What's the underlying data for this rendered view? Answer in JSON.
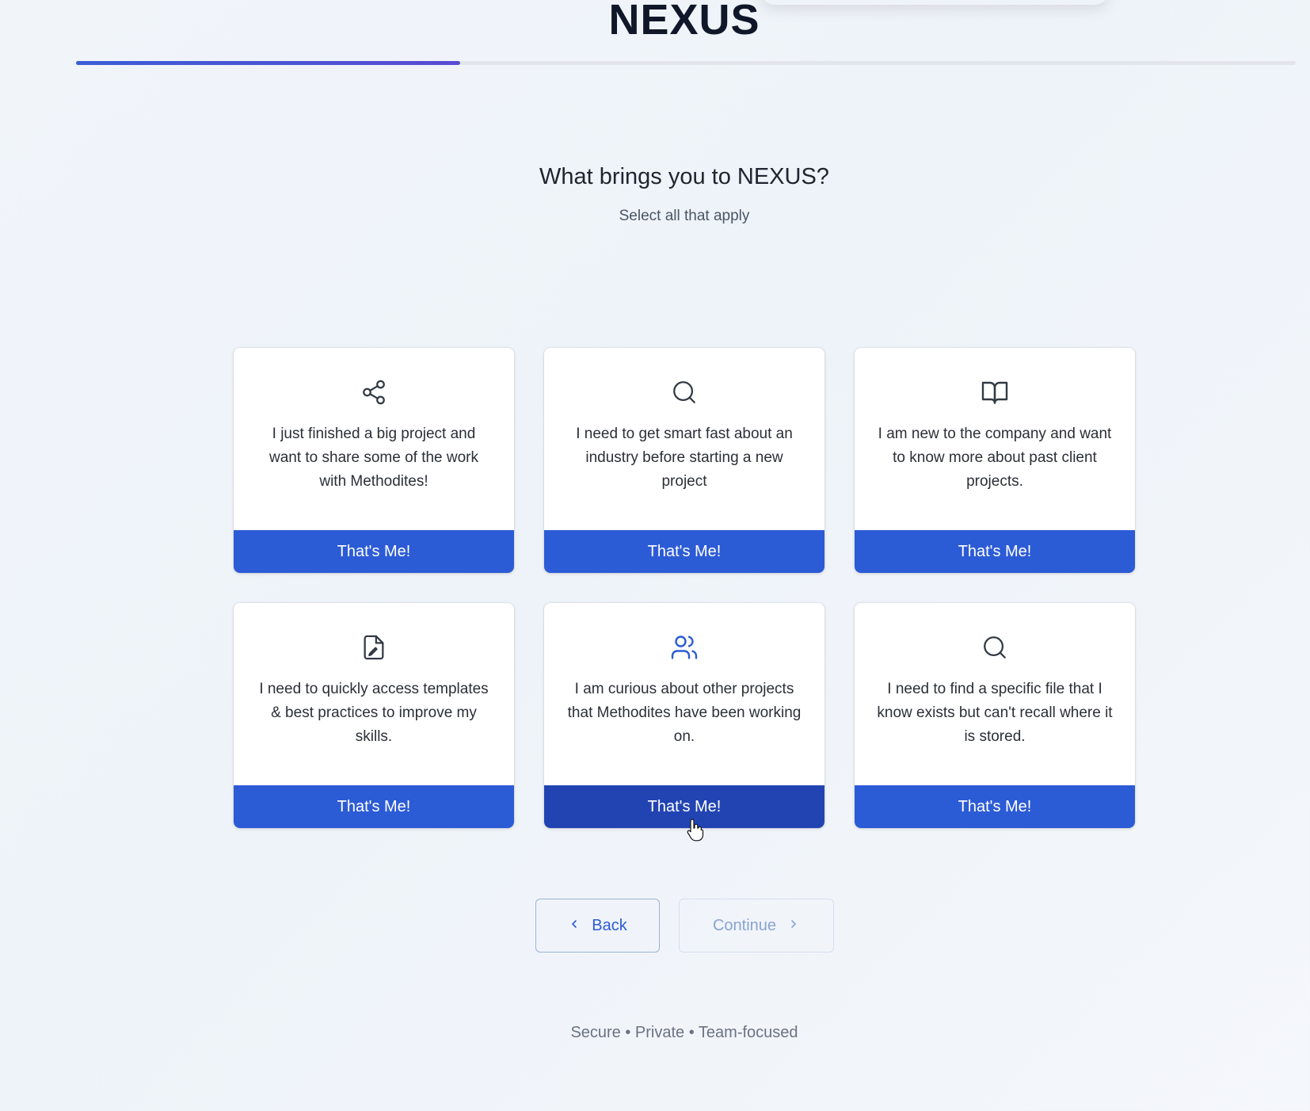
{
  "brand": {
    "name": "NEXUS"
  },
  "progress": {
    "fraction": 0.315
  },
  "heading": "What brings you to NEXUS?",
  "subheading": "Select all that apply",
  "cards": [
    {
      "icon": "share-icon",
      "text": "I just finished a big project and want to share some of the work with Methodites!",
      "button": "That's Me!"
    },
    {
      "icon": "search-icon",
      "text": "I need to get smart fast about an industry before starting a new project",
      "button": "That's Me!"
    },
    {
      "icon": "book-open-icon",
      "text": "I am new to the company and want to know more about past client projects.",
      "button": "That's Me!"
    },
    {
      "icon": "file-edit-icon",
      "text": "I need to quickly access templates & best practices to improve my skills.",
      "button": "That's Me!"
    },
    {
      "icon": "users-icon",
      "text": "I am curious about other projects that Methodites have been working on.",
      "button": "That's Me!"
    },
    {
      "icon": "search-icon",
      "text": "I need to find a specific file that I know exists but can't recall where it is stored.",
      "button": "That's Me!"
    }
  ],
  "nav": {
    "back_label": "Back",
    "continue_label": "Continue"
  },
  "footer": "Secure • Private • Team-focused",
  "colors": {
    "primary": "#2c5bd6",
    "primary_hover": "#2244b3",
    "icon_highlight": "#2c5bd6"
  }
}
